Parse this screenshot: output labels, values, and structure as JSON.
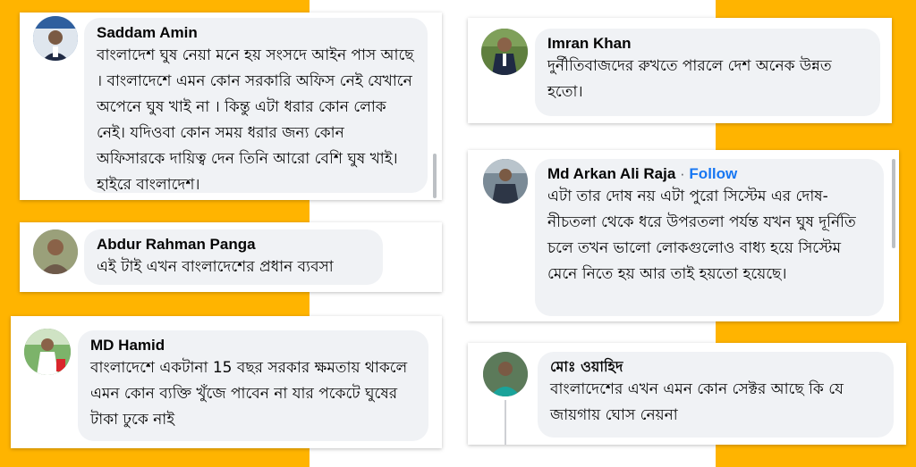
{
  "colors": {
    "background_accent": "#ffb400",
    "card": "#ffffff",
    "bubble": "#f0f2f5",
    "link": "#1877f2"
  },
  "comments": [
    {
      "author": "Saddam Amin",
      "text": "বাংলাদেশ ঘুষ নেয়া মনে হয় সংসদে আইন পাস আছে । বাংলাদেশে এমন কোন সরকারি অফিস নেই যেখানে অপেনে ঘুষ খাই না । কিন্তু এটা ধরার কোন লোক নেই। যদিওবা কোন সময় ধরার জন্য কোন অফিসারকে দায়িত্ব দেন তিনি আরো বেশি ঘুষ খাই। হাইরে বাংলাদেশ।",
      "avatar_icon": "profile-photo-icon"
    },
    {
      "author": "Abdur Rahman Panga",
      "text": "এই টাই এখন বাংলাদেশের প্রধান ব্যবসা",
      "avatar_icon": "profile-photo-icon"
    },
    {
      "author": "MD Hamid",
      "text": "বাংলাদেশে একটানা 15 বছর সরকার ক্ষমতায় থাকলে এমন কোন ব্যক্তি খুঁজে পাবেন না যার পকেটে ঘুষের টাকা ঢুকে নাই",
      "avatar_icon": "profile-photo-icon"
    },
    {
      "author": "Imran Khan",
      "text": "দুর্নীতিবাজদের রুখতে পারলে দেশ অনেক উন্নত হতো।",
      "avatar_icon": "profile-photo-icon"
    },
    {
      "author": "Md Arkan Ali Raja",
      "follow_label": "Follow",
      "separator": "·",
      "text": "এটা তার দোষ নয় এটা পুরো সিস্টেম এর দোষ- নীচতলা থেকে ধরে উপরতলা পর্যন্ত যখন ঘুষ দূর্নিতি চলে তখন ভালো লোকগুলোও বাধ্য হয়ে সিস্টেম মেনে নিতে হয় আর তাই হয়তো হয়েছে।",
      "avatar_icon": "profile-photo-icon"
    },
    {
      "author": "মোঃ ওয়াহিদ",
      "text": "বাংলাদেশের এখন এমন কোন সেক্টর আছে কি যে জায়গায় ঘোস নেয়না",
      "avatar_icon": "profile-photo-icon"
    }
  ]
}
